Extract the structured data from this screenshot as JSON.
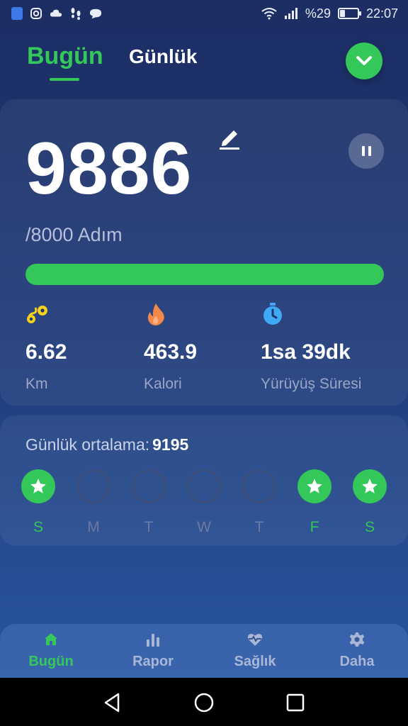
{
  "status_bar": {
    "battery_percent": "%29",
    "battery_level": 0.29,
    "time": "22:07",
    "icons": [
      "shield-icon",
      "instagram-icon",
      "cloud-icon",
      "footsteps-icon",
      "chat-icon",
      "wifi-icon",
      "signal-icon",
      "battery-icon"
    ]
  },
  "header": {
    "tabs": [
      {
        "label": "Bugün",
        "active": true
      },
      {
        "label": "Günlük",
        "active": false
      }
    ],
    "dropdown_icon": "chevron-down-icon"
  },
  "steps": {
    "count": "9886",
    "goal_text": "/8000 Adım",
    "progress": 1.0
  },
  "stats": [
    {
      "icon": "distance-icon",
      "value": "6.62",
      "label": "Km"
    },
    {
      "icon": "flame-icon",
      "value": "463.9",
      "label": "Kalori"
    },
    {
      "icon": "stopwatch-icon",
      "value": "1sa 39dk",
      "label": "Yürüyüş Süresi"
    }
  ],
  "weekly": {
    "average_label": "Günlük ortalama:",
    "average_value": "9195",
    "days": [
      {
        "label": "S",
        "done": true
      },
      {
        "label": "M",
        "done": false
      },
      {
        "label": "T",
        "done": false
      },
      {
        "label": "W",
        "done": false
      },
      {
        "label": "T",
        "done": false
      },
      {
        "label": "F",
        "done": true
      },
      {
        "label": "S",
        "done": true
      }
    ]
  },
  "bottom_nav": [
    {
      "label": "Bugün",
      "icon": "home-icon",
      "active": true
    },
    {
      "label": "Rapor",
      "icon": "bar-chart-icon",
      "active": false
    },
    {
      "label": "Sağlık",
      "icon": "heart-pulse-icon",
      "active": false
    },
    {
      "label": "Daha",
      "icon": "gear-icon",
      "active": false
    }
  ],
  "colors": {
    "accent": "#34c759",
    "background_top": "#1c2d63",
    "background_bottom": "#2a5aa4",
    "distance_icon": "#f5d21c",
    "flame_icon": "#f2894a",
    "stopwatch_icon": "#3fa9f5"
  }
}
